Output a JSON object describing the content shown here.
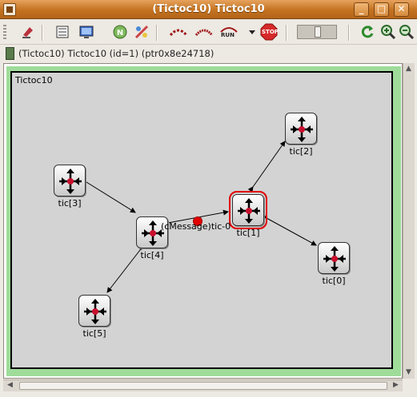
{
  "window": {
    "title": "(Tictoc10) Tictoc10"
  },
  "toolbar": {
    "run_label": "RUN",
    "stop_label": "STOP",
    "icons": [
      "step-icon",
      "object-tree-icon",
      "console-icon",
      "network-icon",
      "find-icon",
      "step-event-icon",
      "fast-run-icon",
      "run-icon",
      "stop-icon",
      "slider-icon",
      "refresh-icon",
      "zoom-in-icon",
      "zoom-out-icon"
    ]
  },
  "infobar": {
    "text": "(Tictoc10) Tictoc10   (id=1)   (ptr0x8e24718)"
  },
  "module": {
    "label": "Tictoc10"
  },
  "nodes": [
    {
      "label": "tic[2]"
    },
    {
      "label": "tic[3]"
    },
    {
      "label": "tic[1]"
    },
    {
      "label": "tic[4]"
    },
    {
      "label": "tic[0]"
    },
    {
      "label": "tic[5]"
    }
  ],
  "message": {
    "label": "(cMessage)tic-0"
  },
  "colors": {
    "title_bar": "#c3721f",
    "module_border": "#9fdc9a",
    "selection": "#e00000",
    "message": "#e30000"
  }
}
